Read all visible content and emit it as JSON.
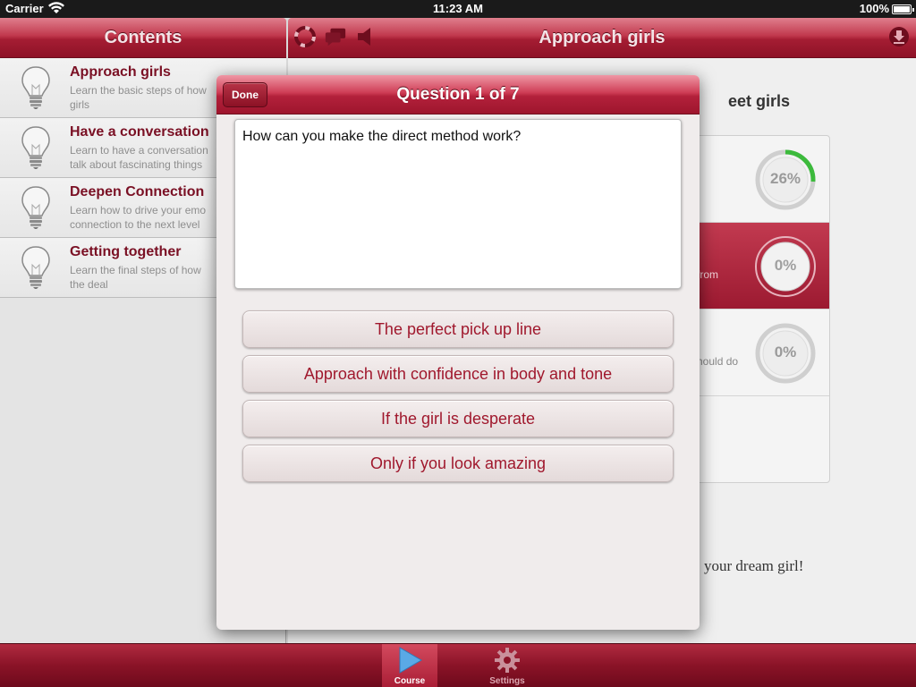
{
  "statusbar": {
    "carrier": "Carrier",
    "time": "11:23 AM",
    "battery": "100%"
  },
  "left_nav": {
    "title": "Contents"
  },
  "right_nav": {
    "title": "Approach girls"
  },
  "contents": [
    {
      "title": "Approach girls",
      "desc_line1": "Learn the basic steps of how",
      "desc_line2": "girls"
    },
    {
      "title": "Have a conversation",
      "desc_line1": "Learn to have a conversation",
      "desc_line2": "talk about fascinating things"
    },
    {
      "title": "Deepen Connection",
      "desc_line1": "Learn how to drive your emo",
      "desc_line2": "connection to the next level"
    },
    {
      "title": "Getting together",
      "desc_line1": "Learn the final steps of how",
      "desc_line2": "the deal"
    }
  ],
  "main": {
    "heading_partial": "eet girls",
    "lessons": [
      {
        "text": "",
        "progress_label": "26%",
        "progress": 0.26
      },
      {
        "text": "from",
        "progress_label": "0%",
        "progress": 0
      },
      {
        "text": "hould do",
        "progress_label": "0%",
        "progress": 0
      }
    ],
    "footer_partial": "your dream girl!"
  },
  "modal": {
    "done_label": "Done",
    "title": "Question 1 of 7",
    "question": "How can you make the direct method work?",
    "answers": [
      "The perfect pick up line",
      "Approach with confidence in body and tone",
      "If the girl is desperate",
      "Only if you look amazing"
    ]
  },
  "tabs": [
    {
      "label": "Course",
      "icon": "play-icon",
      "active": true
    },
    {
      "label": "Settings",
      "icon": "gear-icon",
      "active": false
    }
  ],
  "colors": {
    "accent": "#a51d33",
    "answer_text": "#a0182d",
    "progress_green": "#3cba3c"
  }
}
